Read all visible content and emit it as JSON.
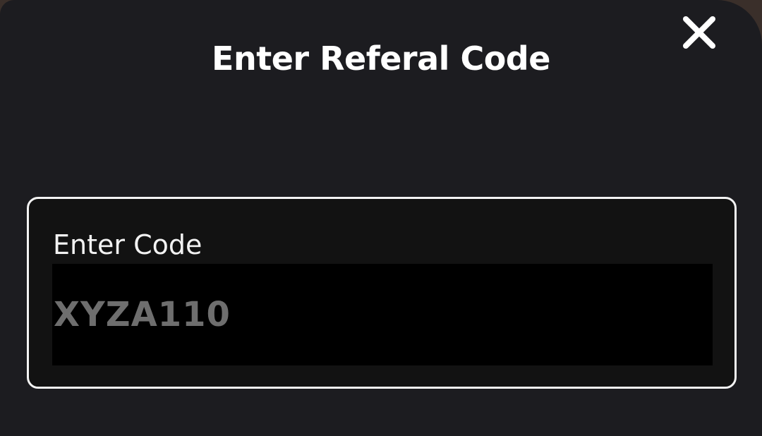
{
  "dialog": {
    "title": "Enter Referal Code",
    "close_icon": "close-icon",
    "code_field": {
      "label": "Enter Code",
      "value": "",
      "placeholder": "XYZA110"
    }
  },
  "colors": {
    "dialog_background": "#1c1c20",
    "card_background": "#121212",
    "card_border": "#f3f3f3",
    "input_background": "#000000",
    "placeholder_text": "#6e6e6e",
    "title_text": "#ffffff"
  }
}
